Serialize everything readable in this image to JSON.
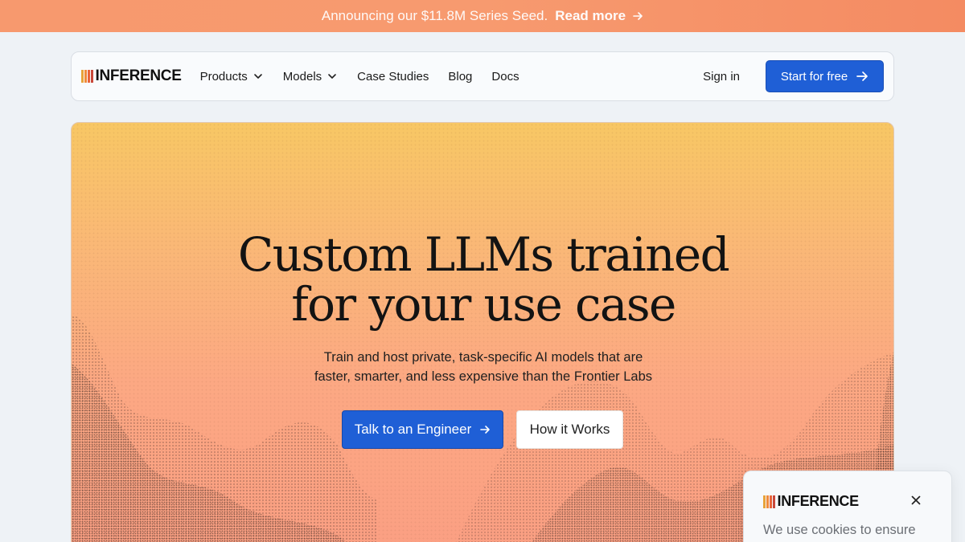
{
  "announcement": {
    "text": "Announcing our $11.8M Series Seed.",
    "link": "Read more",
    "icon": "arrow-right-icon"
  },
  "brand": {
    "name": "INFERENCE",
    "bar_colors": [
      "#e8a33a",
      "#f08a3a",
      "#e8643a",
      "#c9483a",
      "#2f2f2f"
    ]
  },
  "nav": {
    "items": [
      {
        "label": "Products",
        "dropdown": true
      },
      {
        "label": "Models",
        "dropdown": true
      },
      {
        "label": "Case Studies",
        "dropdown": false
      },
      {
        "label": "Blog",
        "dropdown": false
      },
      {
        "label": "Docs",
        "dropdown": false
      }
    ],
    "sign_in": "Sign in",
    "start": "Start for free"
  },
  "hero": {
    "title_line1": "Custom LLMs trained",
    "title_line2": "for your use case",
    "subtitle_line1": "Train and host private, task-specific AI models that are",
    "subtitle_line2": "faster, smarter, and less expensive than the Frontier Labs",
    "primary_cta": "Talk to an Engineer",
    "secondary_cta": "How it Works"
  },
  "cookie": {
    "brand": "INFERENCE",
    "message": "We use cookies to ensure"
  },
  "colors": {
    "accent": "#1f5fd6",
    "announce_bg": "#f7996e",
    "page_bg": "#eef2f6"
  }
}
